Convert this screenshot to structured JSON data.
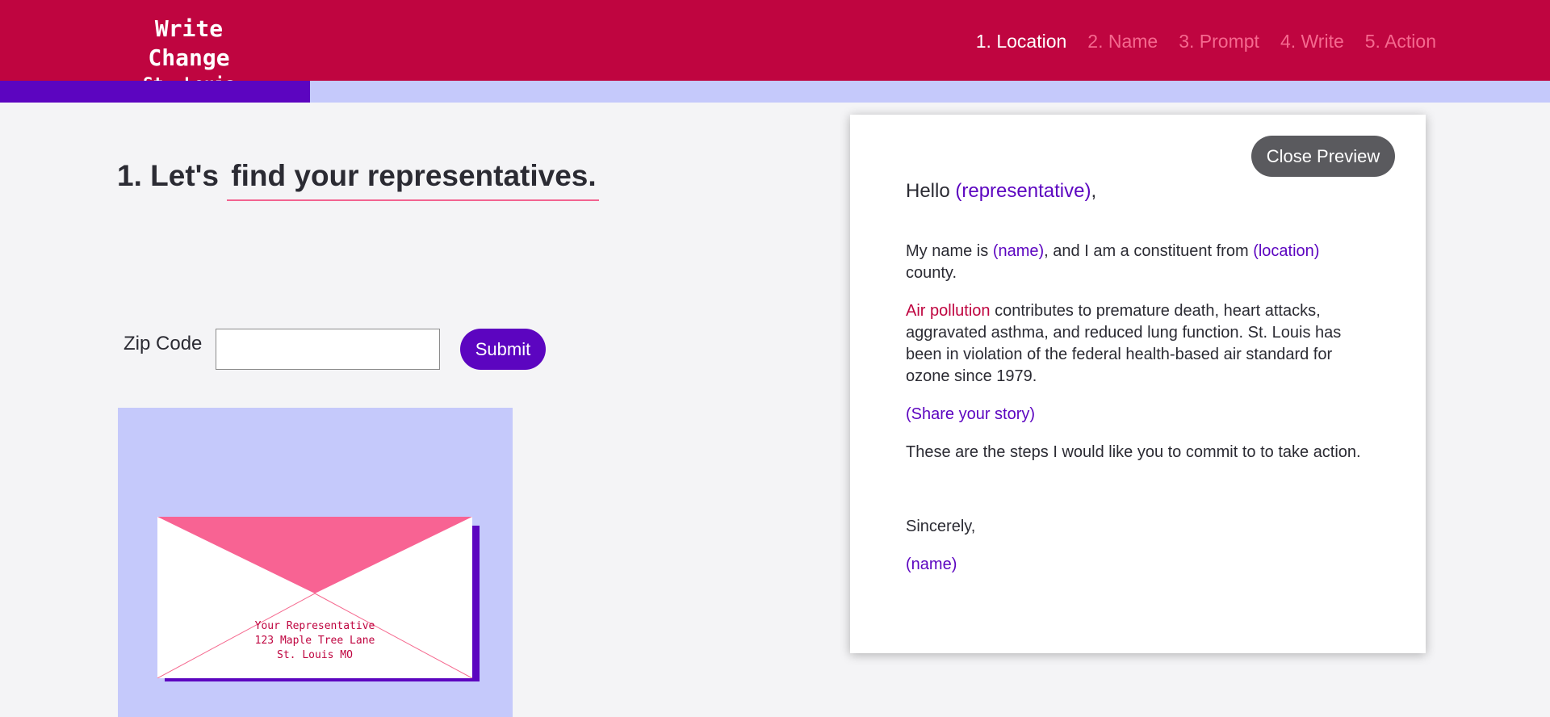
{
  "brand": {
    "title": "Write Change",
    "subtitle": "St. Louis"
  },
  "steps": [
    "1. Location",
    "2. Name",
    "3. Prompt",
    "4. Write",
    "5. Action"
  ],
  "active_step": 0,
  "progress": 0.2,
  "heading": {
    "prefix": "1. Let's",
    "accent": "find your representatives."
  },
  "zip": {
    "label": "Zip Code",
    "value": "",
    "placeholder": ""
  },
  "submit_label": "Submit",
  "envelope": {
    "lines": [
      "Your Representative",
      "123 Maple Tree Lane",
      "St. Louis MO"
    ]
  },
  "preview": {
    "close_label": "Close Preview",
    "greeting_word": "Hello",
    "rep_placeholder": "(representative)",
    "greeting_end": ",",
    "intro_1": "My name is",
    "name_placeholder": "(name)",
    "intro_2": ", and I am a constituent from",
    "location_placeholder": "(location)",
    "intro_3": "county.",
    "topic": "Air pollution",
    "topic_text": "contributes to premature death, heart attacks, aggravated asthma, and reduced lung function. St. Louis has been in violation of the federal health-based air standard for ozone since 1979.",
    "story_placeholder": "(Share your story)",
    "steps_text": "These are the steps I would like you to commit to to take action.",
    "closing": "Sincerely,",
    "signature_placeholder": "(name)"
  },
  "colors": {
    "header": "#bf0540",
    "accent": "#5c05c0",
    "pink": "#f5698f",
    "light": "#c5c9fb"
  }
}
